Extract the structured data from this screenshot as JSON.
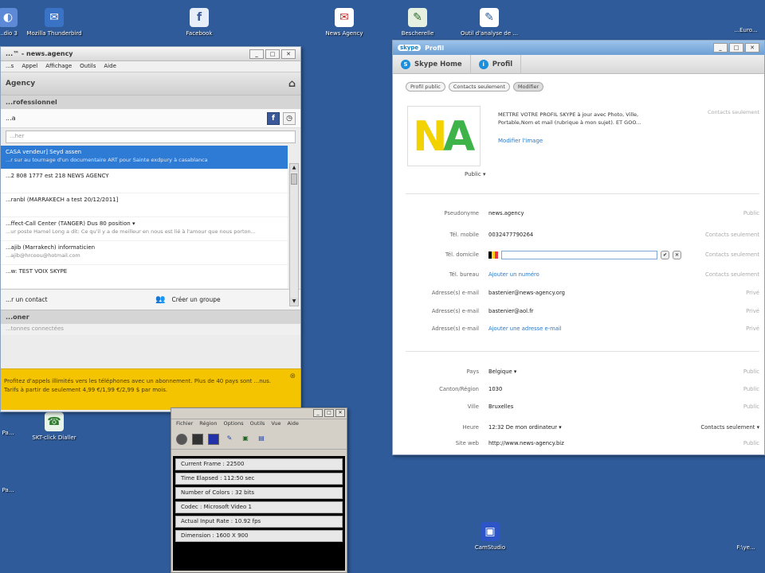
{
  "desktop_icons": [
    {
      "label": "...dio 3",
      "glyph": "◐"
    },
    {
      "label": "Mozilla Thunderbird",
      "glyph": "✉"
    },
    {
      "label": "Facebook",
      "glyph": "f"
    },
    {
      "label": "News Agency",
      "glyph": "✉"
    },
    {
      "label": "Bescherelle",
      "glyph": "✎"
    },
    {
      "label": "Outil d'analyse de ...",
      "glyph": "✎"
    },
    {
      "label": "...Euro...",
      "glyph": ""
    },
    {
      "label": "Pa...",
      "glyph": ""
    },
    {
      "label": "SKT-click Dialler",
      "glyph": "☎"
    },
    {
      "label": "Pa...",
      "glyph": ""
    },
    {
      "label": "CamStudio",
      "glyph": "▣"
    },
    {
      "label": "F:\\ye...",
      "glyph": ""
    }
  ],
  "skype": {
    "title": "...™ - news.agency",
    "window_buttons": [
      "_",
      "□",
      "✕"
    ],
    "menu": [
      "...s",
      "Appel",
      "Affichage",
      "Outils",
      "Aide"
    ],
    "agency_label": "Agency",
    "professional_label": "...rofessionnel",
    "status_text": "...a",
    "search_placeholder": "...her",
    "contacts": [
      {
        "name": "CASA vendeur] Seyd assen",
        "sub": "...r sur au tournage d'un documentaire ART pour Sainte exdpury à casablanca"
      },
      {
        "name": "...2 808 1777 est 218 NEWS AGENCY",
        "sub": ""
      },
      {
        "name": "...ranbl (MARRAKECH a test 20/12/2011]",
        "sub": ""
      },
      {
        "name": "...ffect-Call Center (TANGER) Dus 80 position ▾",
        "sub": "...ur poste Hamel Long a dit: Ce qu'il y a de meilleur en nous est lié à l'amour que nous porton..."
      },
      {
        "name": "...ajib (Marrakech) informaticien",
        "sub": "...ajib@hrcoou@hotmail.com"
      },
      {
        "name": "...w: TEST VOIX SKYPE",
        "sub": ""
      }
    ],
    "add_contact": "...r un contact",
    "create_group": "Créer un groupe",
    "section2": "...oner",
    "connected_info": "...tonnes connectées",
    "promo": "Profitez d'appels illimités vers les téléphones avec un abonnement. Plus de 40 pays sont ...nus. Tarifs à partir de seulement 4,99 €/1,99 €/2,99 $ par mois."
  },
  "profile": {
    "title": "Profil",
    "tabs": [
      {
        "label": "Skype Home",
        "icon": "S"
      },
      {
        "label": "Profil",
        "icon": "i"
      }
    ],
    "pills": [
      "Profil public",
      "Contacts seulement",
      "Modifier"
    ],
    "logo_letters": [
      "N",
      "A"
    ],
    "mood": "METTRE VOTRE PROFIL SKYPE à jour avec Photo, Ville, Portable,Nom et mail (rubrique à mon sujet). ET GOO...",
    "modify_image": "Modifier l'image",
    "contacts_only_top": "Contacts seulement",
    "public_label": "Public ▾",
    "fields": [
      {
        "label": "Pseudonyme",
        "value": "news.agency",
        "privacy": "Public",
        "link": false
      },
      {
        "label": "Tél. mobile",
        "value": "0032477790264",
        "privacy": "Contacts seulement",
        "link": false
      },
      {
        "label": "Tél. domicile",
        "value": "",
        "privacy": "Contacts seulement",
        "link": false
      },
      {
        "label": "Tél. bureau",
        "value": "Ajouter un numéro",
        "privacy": "Contacts seulement",
        "link": true
      },
      {
        "label": "Adresse(s) e-mail",
        "value": "bastenier@news-agency.org",
        "privacy": "Privé",
        "link": false
      },
      {
        "label": "Adresse(s) e-mail",
        "value": "bastenier@aol.fr",
        "privacy": "Privé",
        "link": false
      },
      {
        "label": "Adresse(s) e-mail",
        "value": "Ajouter une adresse e-mail",
        "privacy": "Privé",
        "link": true
      },
      {
        "label": "Pays",
        "value": "Belgique ▾",
        "privacy": "Public",
        "link": false
      },
      {
        "label": "Canton/Région",
        "value": "1030",
        "privacy": "Public",
        "link": false
      },
      {
        "label": "Ville",
        "value": "Bruxelles",
        "privacy": "Public",
        "link": false
      },
      {
        "label": "Heure",
        "value": "12:32   De mon ordinateur ▾",
        "privacy": "Contacts seulement ▾",
        "link": false
      },
      {
        "label": "Site web",
        "value": "http://www.news-agency.biz",
        "privacy": "Public",
        "link": false
      }
    ]
  },
  "camstudio": {
    "menu": [
      "Fichier",
      "Région",
      "Options",
      "Outils",
      "Vue",
      "Aide"
    ],
    "stats": [
      "Current Frame : 22500",
      "Time Elapsed : 112:50 sec",
      "Number of Colors : 32 bits",
      "Codec : Microsoft Video 1",
      "Actual Input Rate : 10.92 fps",
      "Dimension : 1600 X 900"
    ]
  },
  "colors": {
    "desktop": "#2f5b9a",
    "selected": "#2e7bd6",
    "promo": "#f5c400",
    "logo_n": "#f2d200",
    "logo_a": "#3db34a"
  }
}
